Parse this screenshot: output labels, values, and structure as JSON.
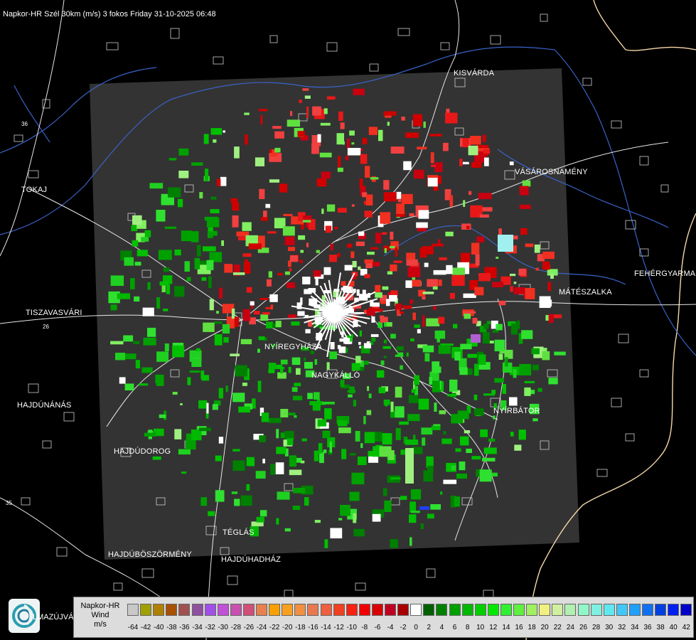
{
  "title": "Napkor-HR Szél 30km (m/s) 3 fokos Friday 31-10-2025 06:48",
  "cities": {
    "kisvarda": "KISVÁRDA",
    "vasarosnameny": "VÁSÁROSNAMÉNY",
    "tokaj": "TOKAJ",
    "fehergyarmat": "FEHÉRGYARMA",
    "mateszalka": "MÁTÉSZALKA",
    "tiszavasvari": "TISZAVASVÁRI",
    "nyiregyhaza": "NYÍREGYHÁZA",
    "nagykallo": "NAGYKÁLLÓ",
    "hajdunanas": "HAJDÚNÁNÁS",
    "nyirbator": "NYÍRBÁTOR",
    "hajdudorog": "HAJDÚDOROG",
    "teglas": "TÉGLÁS",
    "hajduboszormeny": "HAJDÚBÖSZÖRMÉNY",
    "hajduhadhaz": "HAJDÚHADHÁZ",
    "partial": "LMAZÚJVÁR"
  },
  "roads": {
    "r1": "36",
    "r2": "35",
    "r3": "26"
  },
  "legend": {
    "line1": "Napkor-HR",
    "line2": "Wind",
    "line3": "m/s",
    "entries": [
      {
        "label": "-64",
        "color": "#c8c8c8"
      },
      {
        "label": "-42",
        "color": "#a0a000"
      },
      {
        "label": "-40",
        "color": "#b08000"
      },
      {
        "label": "-38",
        "color": "#a85000"
      },
      {
        "label": "-36",
        "color": "#a05050"
      },
      {
        "label": "-34",
        "color": "#9050a0"
      },
      {
        "label": "-32",
        "color": "#a050e8"
      },
      {
        "label": "-30",
        "color": "#c050d8"
      },
      {
        "label": "-28",
        "color": "#c850b0"
      },
      {
        "label": "-26",
        "color": "#d05078"
      },
      {
        "label": "-24",
        "color": "#e88050"
      },
      {
        "label": "-22",
        "color": "#f8a000"
      },
      {
        "label": "-20",
        "color": "#f8a020"
      },
      {
        "label": "-18",
        "color": "#f09040"
      },
      {
        "label": "-16",
        "color": "#e87850"
      },
      {
        "label": "-14",
        "color": "#f06040"
      },
      {
        "label": "-12",
        "color": "#f04020"
      },
      {
        "label": "-10",
        "color": "#f82010"
      },
      {
        "label": "-8",
        "color": "#f00000"
      },
      {
        "label": "-6",
        "color": "#d80000"
      },
      {
        "label": "-4",
        "color": "#c00020"
      },
      {
        "label": "-2",
        "color": "#a80000"
      },
      {
        "label": "0",
        "color": "#ffffff"
      },
      {
        "label": "2",
        "color": "#006000"
      },
      {
        "label": "4",
        "color": "#008000"
      },
      {
        "label": "6",
        "color": "#00a000"
      },
      {
        "label": "8",
        "color": "#00b800"
      },
      {
        "label": "10",
        "color": "#00d000"
      },
      {
        "label": "12",
        "color": "#00e800"
      },
      {
        "label": "14",
        "color": "#30f030"
      },
      {
        "label": "16",
        "color": "#60f040"
      },
      {
        "label": "18",
        "color": "#a0f060"
      },
      {
        "label": "20",
        "color": "#f0f080"
      },
      {
        "label": "22",
        "color": "#d0f0a0"
      },
      {
        "label": "24",
        "color": "#b0f0b0"
      },
      {
        "label": "26",
        "color": "#90f8c8"
      },
      {
        "label": "28",
        "color": "#80f0e0"
      },
      {
        "label": "30",
        "color": "#60e8f0"
      },
      {
        "label": "32",
        "color": "#40c8f8"
      },
      {
        "label": "34",
        "color": "#20a0f8"
      },
      {
        "label": "36",
        "color": "#1070f0"
      },
      {
        "label": "38",
        "color": "#0040e0"
      },
      {
        "label": "40",
        "color": "#0020f0"
      },
      {
        "label": "42",
        "color": "#0000c8"
      }
    ]
  },
  "colors": {
    "background": "#000000",
    "radar_area": "#333333",
    "border": "#f5d7a8",
    "river": "#3a63c8"
  }
}
